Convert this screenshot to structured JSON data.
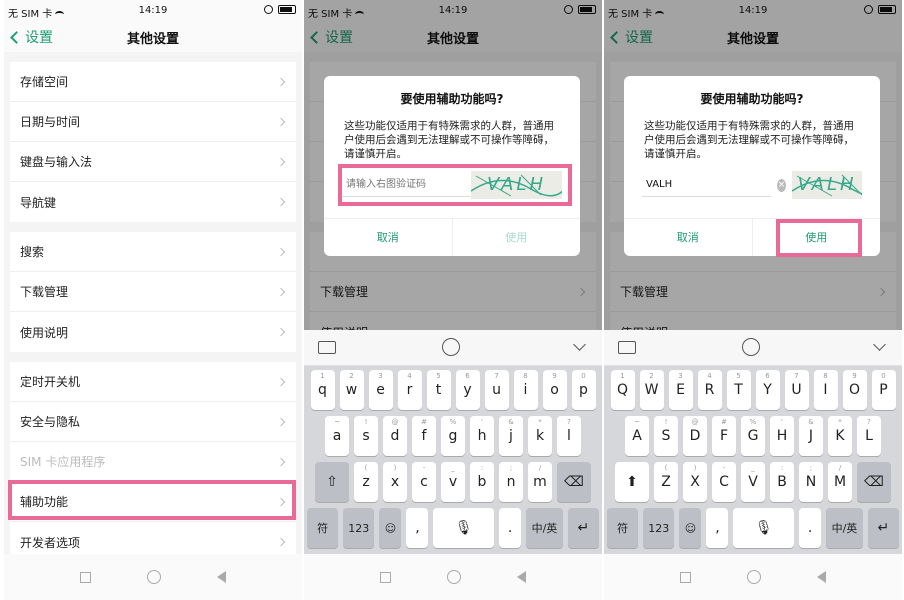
{
  "status": {
    "carrier": "无 SIM 卡",
    "time": "14:19"
  },
  "nav": {
    "back_label": "设置",
    "title": "其他设置"
  },
  "settings_groups": [
    [
      {
        "label": "存储空间"
      },
      {
        "label": "日期与时间"
      },
      {
        "label": "键盘与输入法"
      },
      {
        "label": "导航键"
      }
    ],
    [
      {
        "label": "搜索"
      },
      {
        "label": "下载管理"
      },
      {
        "label": "使用说明"
      }
    ],
    [
      {
        "label": "定时开关机"
      },
      {
        "label": "安全与隐私"
      },
      {
        "label": "SIM 卡应用程序"
      },
      {
        "label": "辅助功能"
      },
      {
        "label": "开发者选项"
      }
    ]
  ],
  "dialog": {
    "title": "要使用辅助功能吗?",
    "body": "这些功能仅适用于有特殊需求的人群，普通用户使用后会遇到无法理解或不可操作等障碍，请谨慎开启。",
    "captcha_placeholder": "请输入右图验证码",
    "captcha_value": "VALH",
    "captcha_text": "VALH",
    "cancel_label": "取消",
    "use_label": "使用"
  },
  "background_rows": {
    "download": "下载管理",
    "usage_partial": "使用说明"
  },
  "keyboard_lower": {
    "row1": [
      "q",
      "w",
      "e",
      "r",
      "t",
      "y",
      "u",
      "i",
      "o",
      "p"
    ],
    "row1_sub": [
      "1",
      "2",
      "3",
      "4",
      "5",
      "6",
      "7",
      "8",
      "9",
      "0"
    ],
    "row2": [
      "a",
      "s",
      "d",
      "f",
      "g",
      "h",
      "j",
      "k",
      "l"
    ],
    "row2_sub": [
      "~",
      "!",
      "@",
      "#",
      "%",
      "'",
      "&",
      "*",
      "?"
    ],
    "row3": [
      "z",
      "x",
      "c",
      "v",
      "b",
      "n",
      "m"
    ],
    "row3_sub": [
      "(",
      ")",
      "-",
      "_",
      ":",
      ";",
      "/"
    ]
  },
  "keyboard_upper": {
    "row1": [
      "Q",
      "W",
      "E",
      "R",
      "T",
      "Y",
      "U",
      "I",
      "O",
      "P"
    ],
    "row2": [
      "A",
      "S",
      "D",
      "F",
      "G",
      "H",
      "J",
      "K",
      "L"
    ],
    "row3": [
      "Z",
      "X",
      "C",
      "V",
      "B",
      "N",
      "M"
    ]
  },
  "keyboard_bottom": {
    "symbol": "符",
    "num": "123",
    "comma": ",",
    "period": ".",
    "lang": "中/英"
  }
}
